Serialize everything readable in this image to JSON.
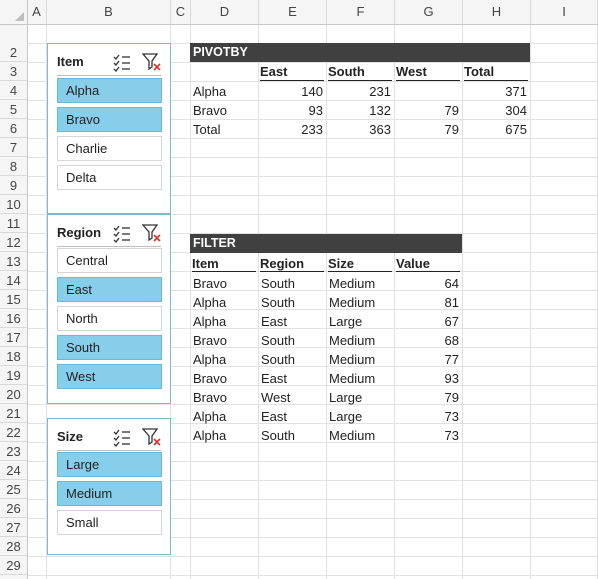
{
  "columns": [
    "A",
    "B",
    "C",
    "D",
    "E",
    "F",
    "G",
    "H",
    "I"
  ],
  "rows": [
    "2",
    "3",
    "4",
    "5",
    "6",
    "7",
    "8",
    "9",
    "10",
    "11",
    "12",
    "13",
    "14",
    "15",
    "16",
    "17",
    "18",
    "19",
    "20",
    "21",
    "22",
    "23",
    "24",
    "25",
    "26",
    "27",
    "28",
    "29"
  ],
  "icons": {
    "multiselect": "multi-select-icon",
    "clearfilter": "clear-filter-icon",
    "clear_color": "#d9342b"
  },
  "slicers": [
    {
      "title": "Item",
      "items": [
        {
          "label": "Alpha",
          "selected": true
        },
        {
          "label": "Bravo",
          "selected": true
        },
        {
          "label": "Charlie",
          "selected": false
        },
        {
          "label": "Delta",
          "selected": false
        }
      ]
    },
    {
      "title": "Region",
      "items": [
        {
          "label": "Central",
          "selected": false
        },
        {
          "label": "East",
          "selected": true
        },
        {
          "label": "North",
          "selected": false
        },
        {
          "label": "South",
          "selected": true
        },
        {
          "label": "West",
          "selected": true
        }
      ]
    },
    {
      "title": "Size",
      "items": [
        {
          "label": "Large",
          "selected": true
        },
        {
          "label": "Medium",
          "selected": true
        },
        {
          "label": "Small",
          "selected": false
        }
      ]
    }
  ],
  "pivot": {
    "title": "PIVOTBY",
    "headers": [
      "East",
      "South",
      "West",
      "Total"
    ],
    "rows": [
      {
        "label": "Alpha",
        "values": [
          "140",
          "231",
          "",
          "371"
        ]
      },
      {
        "label": "Bravo",
        "values": [
          "93",
          "132",
          "79",
          "304"
        ]
      },
      {
        "label": "Total",
        "values": [
          "233",
          "363",
          "79",
          "675"
        ]
      }
    ]
  },
  "filter": {
    "title": "FILTER",
    "headers": [
      "Item",
      "Region",
      "Size",
      "Value"
    ],
    "rows": [
      [
        "Bravo",
        "South",
        "Medium",
        "64"
      ],
      [
        "Alpha",
        "South",
        "Medium",
        "81"
      ],
      [
        "Alpha",
        "East",
        "Large",
        "67"
      ],
      [
        "Bravo",
        "South",
        "Medium",
        "68"
      ],
      [
        "Alpha",
        "South",
        "Medium",
        "77"
      ],
      [
        "Bravo",
        "East",
        "Medium",
        "93"
      ],
      [
        "Bravo",
        "West",
        "Large",
        "79"
      ],
      [
        "Alpha",
        "East",
        "Large",
        "73"
      ],
      [
        "Alpha",
        "South",
        "Medium",
        "73"
      ]
    ]
  }
}
